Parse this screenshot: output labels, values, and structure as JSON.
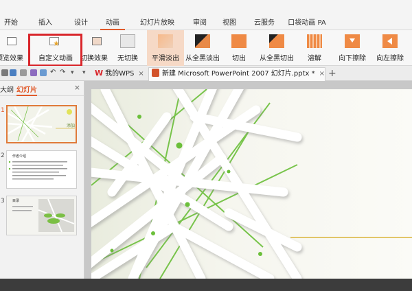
{
  "menu": {
    "tabs": [
      "开始",
      "插入",
      "设计",
      "动画",
      "幻灯片放映",
      "审阅",
      "视图",
      "云服务",
      "口袋动画 PA"
    ],
    "active": "动画"
  },
  "ribbon": {
    "items": [
      {
        "id": "preview",
        "label": "预览效果"
      },
      {
        "id": "custom",
        "label": "自定义动画"
      },
      {
        "id": "switch",
        "label": "切换效果"
      },
      {
        "id": "none",
        "label": "无切换"
      },
      {
        "id": "smooth",
        "label": "平滑淡出"
      },
      {
        "id": "black",
        "label": "从全黑淡出"
      },
      {
        "id": "cut",
        "label": "切出"
      },
      {
        "id": "blackcut",
        "label": "从全黑切出"
      },
      {
        "id": "dissolve",
        "label": "溶解"
      },
      {
        "id": "wipedown",
        "label": "向下擦除"
      },
      {
        "id": "wipeleft",
        "label": "向左擦除"
      }
    ]
  },
  "doc_tabs": [
    {
      "label": "我的WPS",
      "close": "×"
    },
    {
      "label": "新建 Microsoft PowerPoint 2007 幻灯片.pptx *",
      "close": "×"
    }
  ],
  "add_tab": "+",
  "panel": {
    "tab_outline": "大纲",
    "tab_slides": "幻灯片",
    "close": "×",
    "thumbs": [
      {
        "num": "1",
        "caption": "添加"
      },
      {
        "num": "2",
        "caption": "作者介绍"
      },
      {
        "num": "3",
        "caption": "目录"
      }
    ]
  },
  "colors": {
    "accent": "#e05a2b",
    "highlight_box": "#d9262b",
    "selected_thumb": "#e07a3a",
    "slide_line": "#d9b43a",
    "green": "#6bbf3a"
  }
}
